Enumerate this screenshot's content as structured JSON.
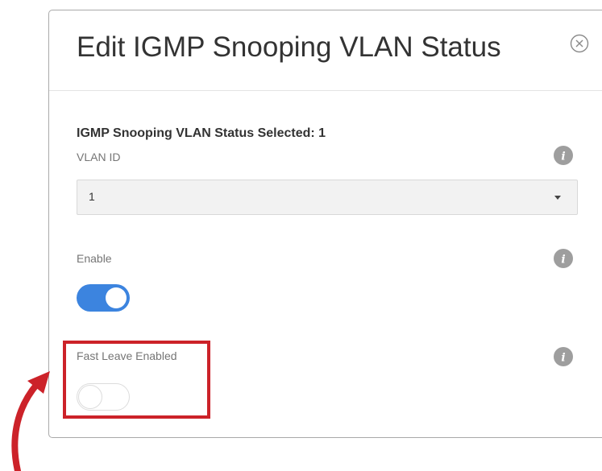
{
  "dialog": {
    "title": "Edit IGMP Snooping VLAN Status",
    "selected_count_text": "IGMP Snooping VLAN Status Selected: 1"
  },
  "fields": {
    "vlan_id": {
      "label": "VLAN ID",
      "value": "1"
    },
    "enable": {
      "label": "Enable",
      "state": "on"
    },
    "fast_leave": {
      "label": "Fast Leave Enabled",
      "state": "off"
    }
  },
  "icons": {
    "close": "close-icon",
    "info": "info-icon",
    "dropdown": "chevron-down-icon"
  },
  "colors": {
    "toggle_on": "#3c84df",
    "highlight": "#cc2229",
    "info_icon": "#9e9e9e"
  }
}
